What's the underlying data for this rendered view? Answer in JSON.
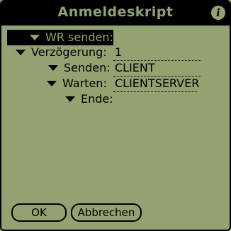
{
  "title": "Anmeldeskript",
  "icons": {
    "info": "info-icon",
    "collapse": "triangle-down-icon"
  },
  "tree": [
    {
      "label": "WR senden:",
      "value": "",
      "selected": true
    },
    {
      "label": "Verzögerung:",
      "value": "1"
    },
    {
      "label": "Senden:",
      "value": "CLIENT"
    },
    {
      "label": "Warten:",
      "value": "CLIENTSERVER"
    },
    {
      "label": "Ende:",
      "value": ""
    }
  ],
  "buttons": {
    "ok": "OK",
    "cancel": "Abbrechen"
  },
  "colors": {
    "background": "#93a270",
    "foreground": "#000000"
  }
}
